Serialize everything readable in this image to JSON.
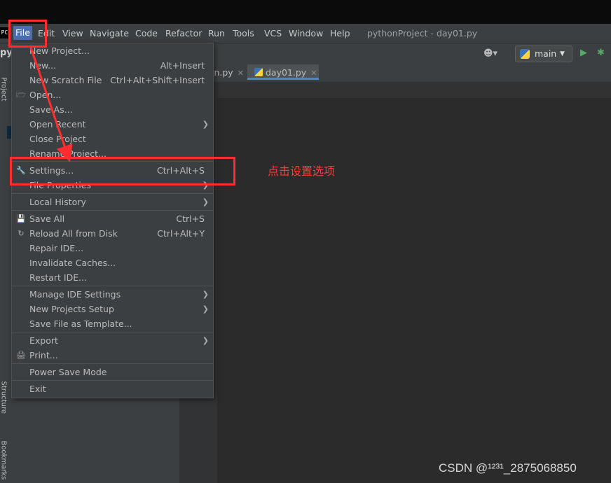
{
  "app": {
    "logo_text": "PC",
    "window_title": "pythonProject - day01.py"
  },
  "menubar": {
    "items": [
      "File",
      "Edit",
      "View",
      "Navigate",
      "Code",
      "Refactor",
      "Run",
      "Tools",
      "VCS",
      "Window",
      "Help"
    ]
  },
  "toolbar": {
    "project_crumb": "py",
    "run_config": "main"
  },
  "left_stripe": {
    "project_label": "Project",
    "structure_label": "Structure",
    "bookmarks_label": "Bookmarks"
  },
  "tabs": [
    {
      "label": "in.py",
      "active": false
    },
    {
      "label": "day01.py",
      "active": true
    }
  ],
  "file_menu": {
    "items": [
      {
        "label": "New Project...",
        "shortcut": ""
      },
      {
        "label": "New...",
        "shortcut": "Alt+Insert"
      },
      {
        "label": "New Scratch File",
        "shortcut": "Ctrl+Alt+Shift+Insert"
      },
      {
        "label": "Open...",
        "shortcut": "",
        "icon": "folder-icon"
      },
      {
        "label": "Save As...",
        "shortcut": ""
      },
      {
        "label": "Open Recent",
        "shortcut": "",
        "submenu": true
      },
      {
        "label": "Close Project",
        "shortcut": ""
      },
      {
        "label": "Rename Project...",
        "shortcut": ""
      },
      {
        "label": "Settings...",
        "shortcut": "Ctrl+Alt+S",
        "icon": "wrench-icon"
      },
      {
        "label": "File Properties",
        "shortcut": "",
        "submenu": true
      },
      {
        "label": "Local History",
        "shortcut": "",
        "submenu": true
      },
      {
        "label": "Save All",
        "shortcut": "Ctrl+S",
        "icon": "save-icon"
      },
      {
        "label": "Reload All from Disk",
        "shortcut": "Ctrl+Alt+Y",
        "icon": "reload-icon"
      },
      {
        "label": "Repair IDE...",
        "shortcut": ""
      },
      {
        "label": "Invalidate Caches...",
        "shortcut": ""
      },
      {
        "label": "Restart IDE...",
        "shortcut": ""
      },
      {
        "label": "Manage IDE Settings",
        "shortcut": "",
        "submenu": true
      },
      {
        "label": "New Projects Setup",
        "shortcut": "",
        "submenu": true
      },
      {
        "label": "Save File as Template...",
        "shortcut": ""
      },
      {
        "label": "Export",
        "shortcut": "",
        "submenu": true
      },
      {
        "label": "Print...",
        "shortcut": "",
        "icon": "print-icon"
      },
      {
        "label": "Power Save Mode",
        "shortcut": ""
      },
      {
        "label": "Exit",
        "shortcut": ""
      }
    ]
  },
  "annotation": {
    "text": "点击设置选项",
    "color": "#ff3b3b"
  },
  "watermark": "CSDN @¹²³¹_2875068850",
  "colors": {
    "highlight": "#ff2d2d",
    "menu_active": "#4b6eaf",
    "background": "#2b2b2b"
  }
}
